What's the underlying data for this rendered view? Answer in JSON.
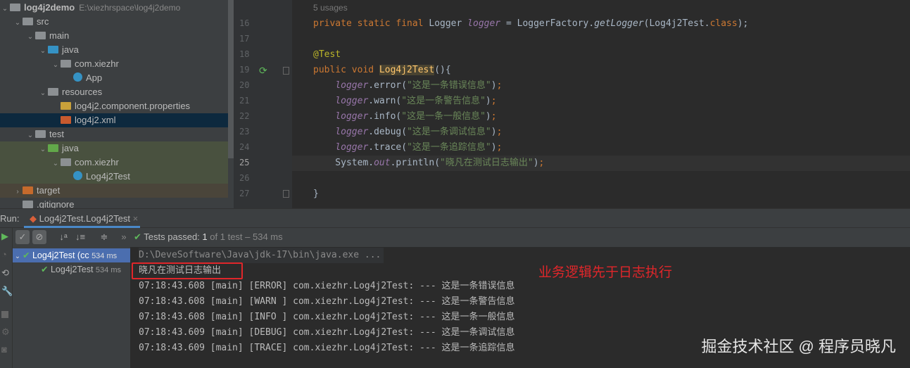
{
  "project_tree": {
    "root": {
      "name": "log4j2demo",
      "path": "E:\\xiezhrspace\\log4j2demo"
    },
    "items": [
      {
        "label": "src",
        "depth": 1,
        "expanded": true,
        "icon": "folder-icon",
        "color": "#8c9093"
      },
      {
        "label": "main",
        "depth": 2,
        "expanded": true,
        "icon": "folder-icon",
        "color": "#8c9093"
      },
      {
        "label": "java",
        "depth": 3,
        "expanded": true,
        "icon": "source-folder-icon",
        "color": "#3592c4"
      },
      {
        "label": "com.xiezhr",
        "depth": 4,
        "expanded": true,
        "icon": "package-icon",
        "color": "#8c9093"
      },
      {
        "label": "App",
        "depth": 5,
        "icon": "java-class-icon",
        "color": "#3592c4"
      },
      {
        "label": "resources",
        "depth": 3,
        "expanded": true,
        "icon": "resources-folder-icon",
        "color": "#8c9093"
      },
      {
        "label": "log4j2.component.properties",
        "depth": 4,
        "icon": "properties-file-icon",
        "color": "#c9a13a"
      },
      {
        "label": "log4j2.xml",
        "depth": 4,
        "icon": "xml-file-icon",
        "color": "#c75a2e",
        "selected": true
      },
      {
        "label": "test",
        "depth": 2,
        "expanded": true,
        "icon": "folder-icon",
        "color": "#8c9093"
      },
      {
        "label": "java",
        "depth": 3,
        "expanded": true,
        "icon": "test-folder-icon",
        "color": "#62a84a",
        "test": true
      },
      {
        "label": "com.xiezhr",
        "depth": 4,
        "expanded": true,
        "icon": "package-icon",
        "color": "#8c9093",
        "test": true
      },
      {
        "label": "Log4j2Test",
        "depth": 5,
        "icon": "java-class-icon",
        "color": "#3592c4",
        "test": true
      },
      {
        "label": "target",
        "depth": 1,
        "expanded": false,
        "icon": "folder-icon",
        "color": "#c56a2c",
        "target": true
      },
      {
        "label": ".gitignore",
        "depth": 1,
        "icon": "file-icon",
        "color": "#8c9093"
      }
    ]
  },
  "editor": {
    "usages": "5 usages",
    "current_line": 25,
    "lines": [
      {
        "n": "16",
        "tokens": [
          [
            "private static final ",
            "kw"
          ],
          [
            "Logger ",
            "plain"
          ],
          [
            "logger",
            "it"
          ],
          [
            " = LoggerFactory.",
            "plain"
          ],
          [
            "getLogger",
            "fn"
          ],
          [
            "(Log4j2Test.",
            "plain"
          ],
          [
            "class",
            "kw"
          ],
          [
            ");",
            "plain"
          ]
        ]
      },
      {
        "n": "17",
        "tokens": []
      },
      {
        "n": "18",
        "tokens": [
          [
            "@Test",
            "ann"
          ]
        ]
      },
      {
        "n": "19",
        "tokens": [
          [
            "public void ",
            "kw"
          ],
          [
            "Log4j2Test",
            "hl"
          ],
          [
            "(){",
            "plain"
          ]
        ]
      },
      {
        "n": "20",
        "tokens": [
          [
            "    ",
            "plain"
          ],
          [
            "logger",
            "it"
          ],
          [
            ".error(",
            "plain"
          ],
          [
            "\"这是一条错误信息\"",
            "str"
          ],
          [
            ")",
            "plain"
          ],
          [
            ";",
            "kw"
          ]
        ]
      },
      {
        "n": "21",
        "tokens": [
          [
            "    ",
            "plain"
          ],
          [
            "logger",
            "it"
          ],
          [
            ".warn(",
            "plain"
          ],
          [
            "\"这是一条警告信息\"",
            "str"
          ],
          [
            ")",
            "plain"
          ],
          [
            ";",
            "kw"
          ]
        ]
      },
      {
        "n": "22",
        "tokens": [
          [
            "    ",
            "plain"
          ],
          [
            "logger",
            "it"
          ],
          [
            ".info(",
            "plain"
          ],
          [
            "\"这是一条一般信息\"",
            "str"
          ],
          [
            ")",
            "plain"
          ],
          [
            ";",
            "kw"
          ]
        ]
      },
      {
        "n": "23",
        "tokens": [
          [
            "    ",
            "plain"
          ],
          [
            "logger",
            "it"
          ],
          [
            ".debug(",
            "plain"
          ],
          [
            "\"这是一条调试信息\"",
            "str"
          ],
          [
            ")",
            "plain"
          ],
          [
            ";",
            "kw"
          ]
        ]
      },
      {
        "n": "24",
        "tokens": [
          [
            "    ",
            "plain"
          ],
          [
            "logger",
            "it"
          ],
          [
            ".trace(",
            "plain"
          ],
          [
            "\"这是一条追踪信息\"",
            "str"
          ],
          [
            ")",
            "plain"
          ],
          [
            ";",
            "kw"
          ]
        ]
      },
      {
        "n": "25",
        "tokens": [
          [
            "    System.",
            "plain"
          ],
          [
            "out",
            "it"
          ],
          [
            ".println(",
            "plain"
          ],
          [
            "\"晓凡在测试日志输出\"",
            "str"
          ],
          [
            ")",
            "plain"
          ],
          [
            ";",
            "kw"
          ]
        ]
      },
      {
        "n": "26",
        "tokens": []
      },
      {
        "n": "27",
        "tokens": [
          [
            "}",
            "plain"
          ]
        ]
      }
    ]
  },
  "run_panel": {
    "label": "Run:",
    "tab": "Log4j2Test.Log4j2Test",
    "status_prefix": "Tests passed:",
    "status_count": "1",
    "status_suffix": "of 1 test – 534 ms",
    "tests": [
      {
        "label": "Log4j2Test (cc",
        "time": "534 ms",
        "selected": true
      },
      {
        "label": "Log4j2Test",
        "time": "534 ms"
      }
    ],
    "console": {
      "command": "D:\\DeveSoftware\\Java\\jdk-17\\bin\\java.exe ...",
      "println": "晓凡在测试日志输出",
      "logs": [
        "07:18:43.608 [main] [ERROR] com.xiezhr.Log4j2Test: --- 这是一条错误信息",
        "07:18:43.608 [main] [WARN ] com.xiezhr.Log4j2Test: --- 这是一条警告信息",
        "07:18:43.608 [main] [INFO ] com.xiezhr.Log4j2Test: --- 这是一条一般信息",
        "07:18:43.609 [main] [DEBUG] com.xiezhr.Log4j2Test: --- 这是一条调试信息",
        "07:18:43.609 [main] [TRACE] com.xiezhr.Log4j2Test: --- 这是一条追踪信息"
      ]
    }
  },
  "annotation": "业务逻辑先于日志执行",
  "watermark": "掘金技术社区 @ 程序员晓凡"
}
